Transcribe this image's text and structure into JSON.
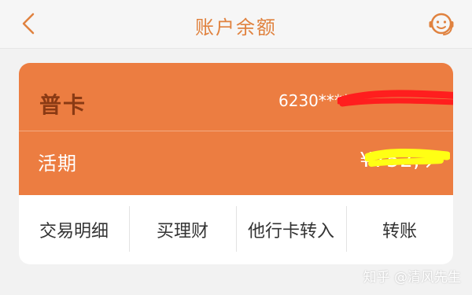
{
  "header": {
    "title": "账户余额",
    "back_icon": "chevron-left-icon",
    "support_icon": "customer-service-icon"
  },
  "card": {
    "type": "普卡",
    "number": "6230*****",
    "account_type": "活期",
    "balance": "¥752,"
  },
  "actions": [
    {
      "label": "交易明细"
    },
    {
      "label": "买理财"
    },
    {
      "label": "他行卡转入"
    },
    {
      "label": "转账"
    }
  ],
  "watermark": "知乎 @清风先生",
  "colors": {
    "accent": "#e0823f",
    "card_orange": "#ec7d41",
    "card_type_text": "#8a3a14",
    "redact_red": "#ff1e1e",
    "redact_yellow": "#ffff14"
  }
}
